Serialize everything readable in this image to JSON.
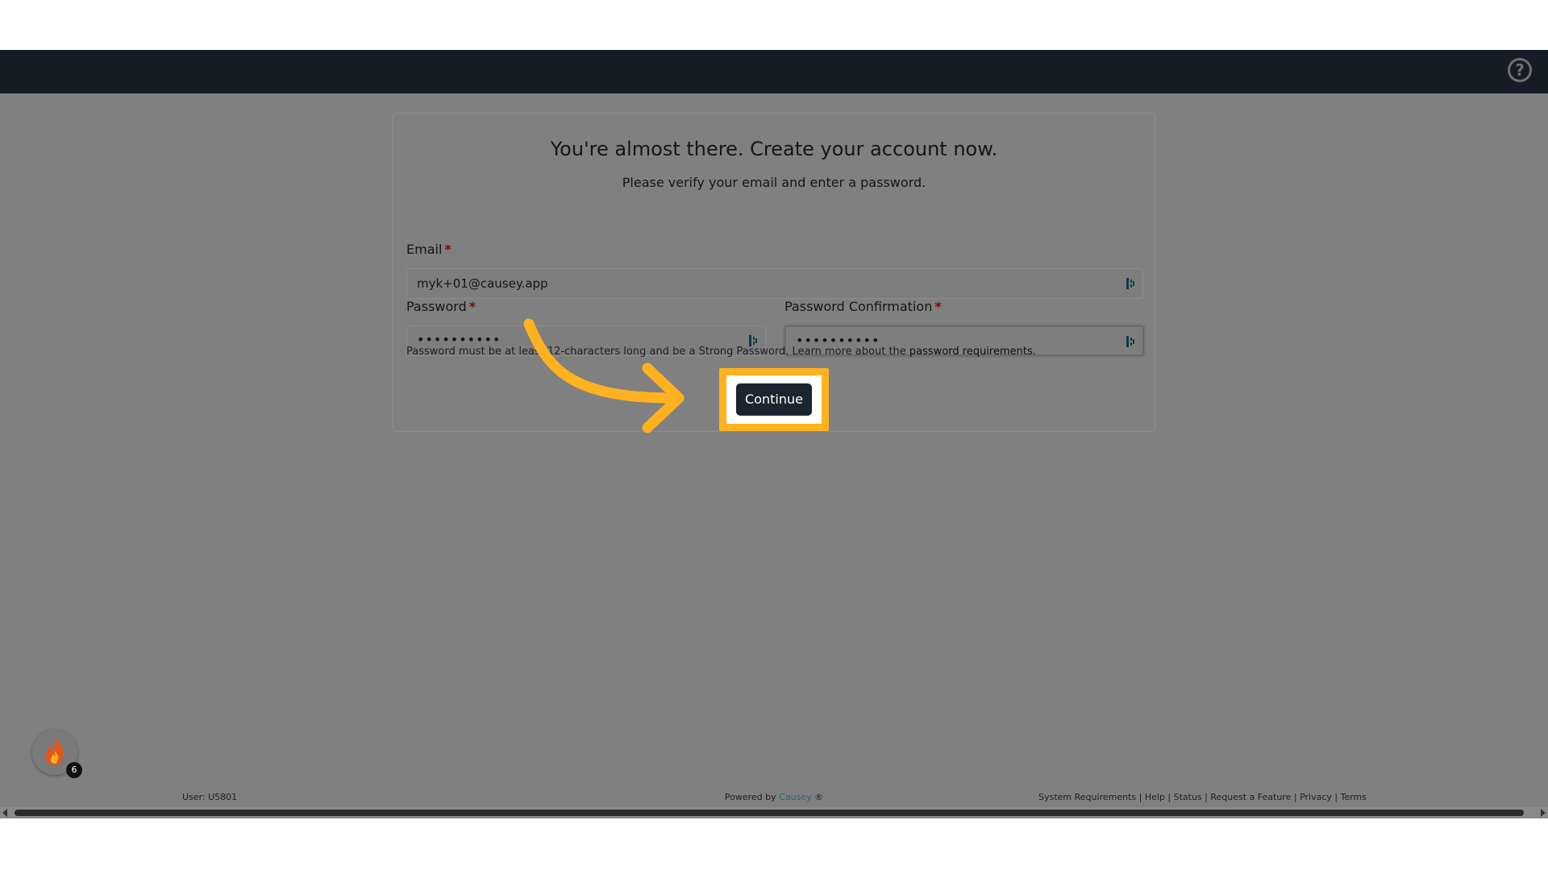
{
  "card": {
    "title": "You're almost there. Create your account now.",
    "subtitle": "Please verify your email and enter a password."
  },
  "form": {
    "email_label": "Email",
    "email_value": "myk+01@causey.app",
    "password_label": "Password",
    "password_value": "••••••••••",
    "confirm_label": "Password Confirmation",
    "confirm_value": "••••••••••",
    "required_mark": "*",
    "hint_text": "Password must be at least 12-characters long and be a Strong Password. Learn more about the ",
    "hint_link": "password requirements",
    "hint_end": ".",
    "continue_label": "Continue"
  },
  "streak": {
    "count": "6"
  },
  "footer": {
    "user": "User: U5801",
    "powered_prefix": "Powered by ",
    "brand": "Causey",
    "powered_suffix": " ®",
    "links": [
      "System Requirements",
      "Help",
      "Status",
      "Request a Feature",
      "Privacy",
      "Terms"
    ]
  },
  "colors": {
    "topbar": "#141d26",
    "overlay": "#808080",
    "highlight": "#ffb21f",
    "button": "#1a2530",
    "required": "#7a0c0c"
  },
  "icons": [
    "help-icon",
    "password-manager-icon",
    "flame-icon",
    "arrow-icon"
  ]
}
